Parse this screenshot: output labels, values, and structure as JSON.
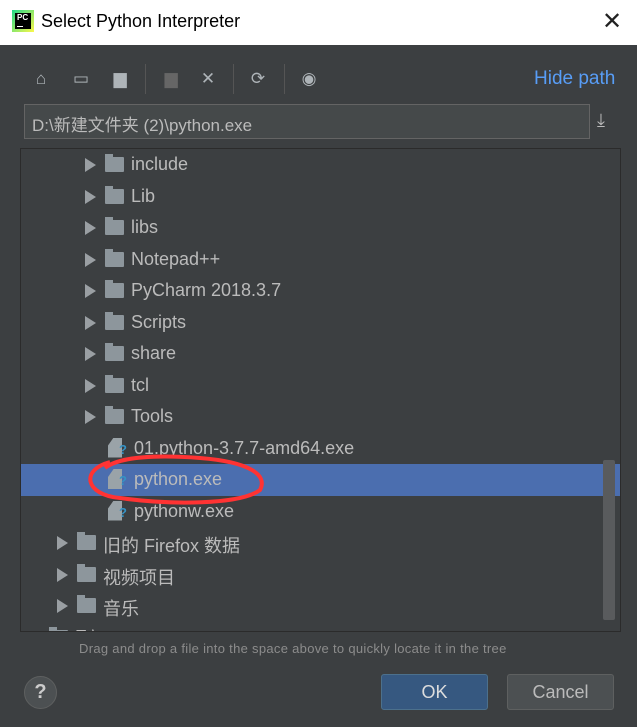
{
  "window": {
    "title": "Select Python Interpreter",
    "close_icon": "close-icon"
  },
  "toolbar": {
    "icons": [
      "home-icon",
      "desktop-icon",
      "project-folder-icon",
      "new-folder-icon",
      "delete-icon",
      "refresh-icon",
      "show-hidden-icon"
    ],
    "hide_path": "Hide path"
  },
  "path": {
    "value": "D:\\新建文件夹 (2)\\python.exe"
  },
  "tree": {
    "rows": [
      {
        "label": "include",
        "type": "folder",
        "level": 2
      },
      {
        "label": "Lib",
        "type": "folder",
        "level": 2
      },
      {
        "label": "libs",
        "type": "folder",
        "level": 2
      },
      {
        "label": "Notepad++",
        "type": "folder",
        "level": 2
      },
      {
        "label": "PyCharm 2018.3.7",
        "type": "folder",
        "level": 2
      },
      {
        "label": "Scripts",
        "type": "folder",
        "level": 2
      },
      {
        "label": "share",
        "type": "folder",
        "level": 2
      },
      {
        "label": "tcl",
        "type": "folder",
        "level": 2
      },
      {
        "label": "Tools",
        "type": "folder",
        "level": 2
      },
      {
        "label": "01.python-3.7.7-amd64.exe",
        "type": "file",
        "level": 2
      },
      {
        "label": "python.exe",
        "type": "file",
        "level": 2,
        "selected": true
      },
      {
        "label": "pythonw.exe",
        "type": "file",
        "level": 2
      },
      {
        "label": "旧的 Firefox 数据",
        "type": "folder",
        "level": 1
      },
      {
        "label": "视频项目",
        "type": "folder",
        "level": 1
      },
      {
        "label": "音乐",
        "type": "folder",
        "level": 1
      },
      {
        "label": "E:\\",
        "type": "folder",
        "level": 0
      }
    ]
  },
  "hint": "Drag and drop a file into the space above to quickly locate it in the tree",
  "buttons": {
    "help": "?",
    "ok": "OK",
    "cancel": "Cancel"
  },
  "colors": {
    "selection": "#4b6eaf",
    "link": "#589df6",
    "annotation": "#ff3333"
  }
}
